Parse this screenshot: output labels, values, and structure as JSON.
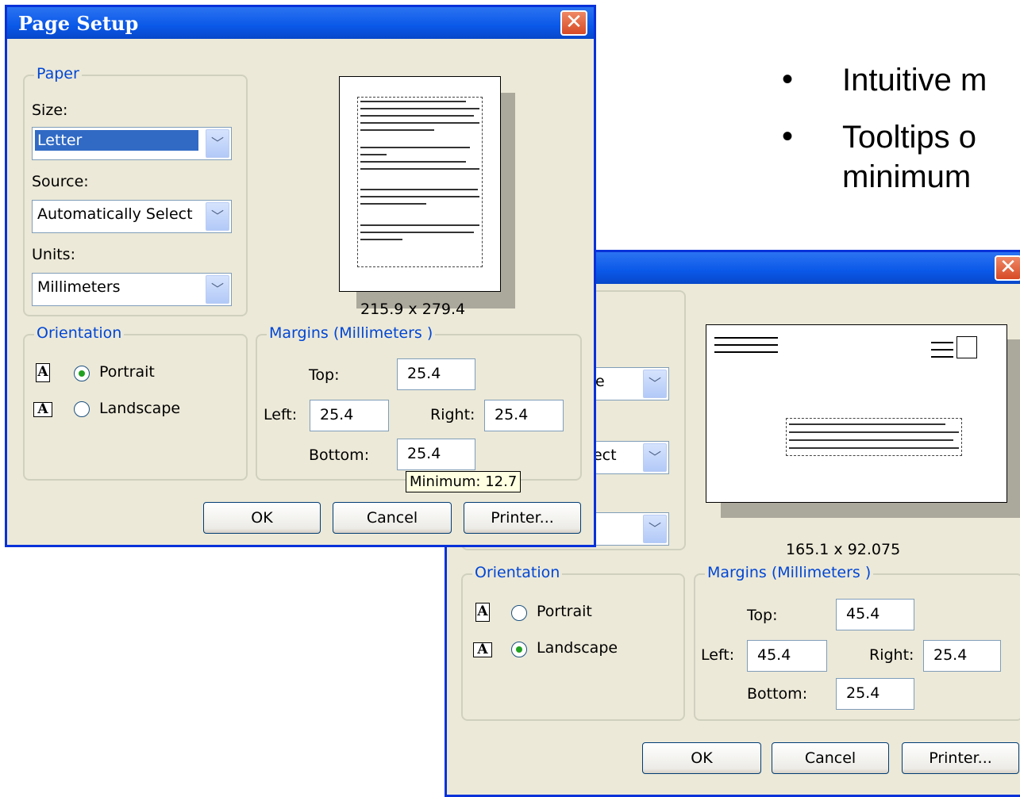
{
  "slide": {
    "bullets": [
      {
        "symbol": "•",
        "text": "Intuitive m"
      },
      {
        "symbol": "•",
        "text": "Tooltips o"
      },
      {
        "symbol": "",
        "text": "minimum"
      }
    ]
  },
  "dialog_front": {
    "title": "Page Setup",
    "close_symbol": "✕",
    "paper_group": "Paper",
    "size_label": "Size:",
    "size_value": "Letter",
    "source_label": "Source:",
    "source_value": "Automatically Select",
    "units_label": "Units:",
    "units_value": "Millimeters",
    "paper_dimensions": "215.9 x 279.4",
    "orientation_group": "Orientation",
    "portrait_icon": "A",
    "portrait_label": "Portrait",
    "landscape_icon": "A",
    "landscape_label": "Landscape",
    "margins_group": "Margins (Millimeters )",
    "top_label": "Top:",
    "top_value": "25.4",
    "left_label": "Left:",
    "left_value": "25.4",
    "right_label": "Right:",
    "right_value": "25.4",
    "bottom_label": "Bottom:",
    "bottom_value": "25.4",
    "tooltip": "Minimum: 12.7",
    "ok_label": "OK",
    "cancel_label": "Cancel",
    "printer_label": "Printer...",
    "selected_orientation": "portrait"
  },
  "dialog_back": {
    "close_symbol": "✕",
    "size_value_partial": "pe",
    "source_value_partial": "elect",
    "paper_dimensions": "165.1 x 92.075",
    "orientation_group": "Orientation",
    "portrait_icon": "A",
    "portrait_label": "Portrait",
    "landscape_icon": "A",
    "landscape_label": "Landscape",
    "margins_group": "Margins (Millimeters )",
    "top_label": "Top:",
    "top_value": "45.4",
    "left_label": "Left:",
    "left_value": "45.4",
    "right_label": "Right:",
    "right_value": "25.4",
    "bottom_label": "Bottom:",
    "bottom_value": "25.4",
    "ok_label": "OK",
    "cancel_label": "Cancel",
    "printer_label": "Printer...",
    "selected_orientation": "landscape"
  },
  "icons": {
    "dropdown": "chevron-down-icon",
    "close": "close-icon",
    "envelope_stamp": "stamp-icon"
  },
  "colors": {
    "dialog_bg": "#ece9d8",
    "titlebar": "#0a58e8",
    "group_label": "#0046d5",
    "selection": "#316ac5",
    "tooltip_bg": "#ffffe1"
  }
}
